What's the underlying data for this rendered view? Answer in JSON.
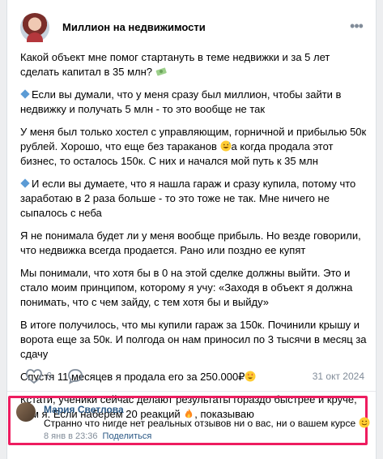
{
  "post": {
    "author": "Миллион на недвижимости",
    "paragraphs": [
      "Какой объект мне помог стартануть в теме недвижки и за 5 лет сделать капитал в 35 млн?",
      "Если вы думали, что у меня сразу был миллион, чтобы зайти в недвижку и получать 5 млн - то это вообще не так",
      "У меня был только хостел с управляющим, горничной и прибылью 50к рублей. Хорошо, что еще без тараканов",
      "а когда продала этот бизнес, то осталось 150к. С них и начался мой путь к 35 млн",
      "И если вы думаете, что я нашла гараж и сразу купила, потому что заработаю в 2 раза больше - то это тоже не так. Мне ничего не сыпалось с неба",
      "Я не понимала будет ли у меня вообще прибыль. Но везде говорили, что недвижка всегда продается. Рано или поздно ее купят",
      "Мы понимали, что хотя бы в 0 на этой сделке должны выйти. Это и стало моим принципом, которому я учу: «Заходя в объект я должна понимать, что с чем зайду, с тем хотя бы и выйду»",
      "В итоге получилось, что мы купили гараж за 150к. Починили крышу и ворота еще за 50к. И полгода он нам приносил по 3 тысячи в месяц за сдачу",
      "Спустя 11 месяцев я продала его за 250.000₽",
      "Кстати, ученики сейчас делают результаты гораздо быстрее и круче, чем я. Если наберем 20 реакций",
      ", показываю"
    ],
    "likes": "6",
    "date": "31 окт 2024"
  },
  "comment": {
    "author": "Мария Светлова",
    "text": "Странно что нигде нет реальных отзывов ни о вас, ни о вашем курсе",
    "time": "8 янв в 23:36",
    "share_label": "Поделиться"
  },
  "colors": {
    "highlight": "#ee1c5f",
    "link": "#2a5885",
    "muted": "#818c99"
  }
}
